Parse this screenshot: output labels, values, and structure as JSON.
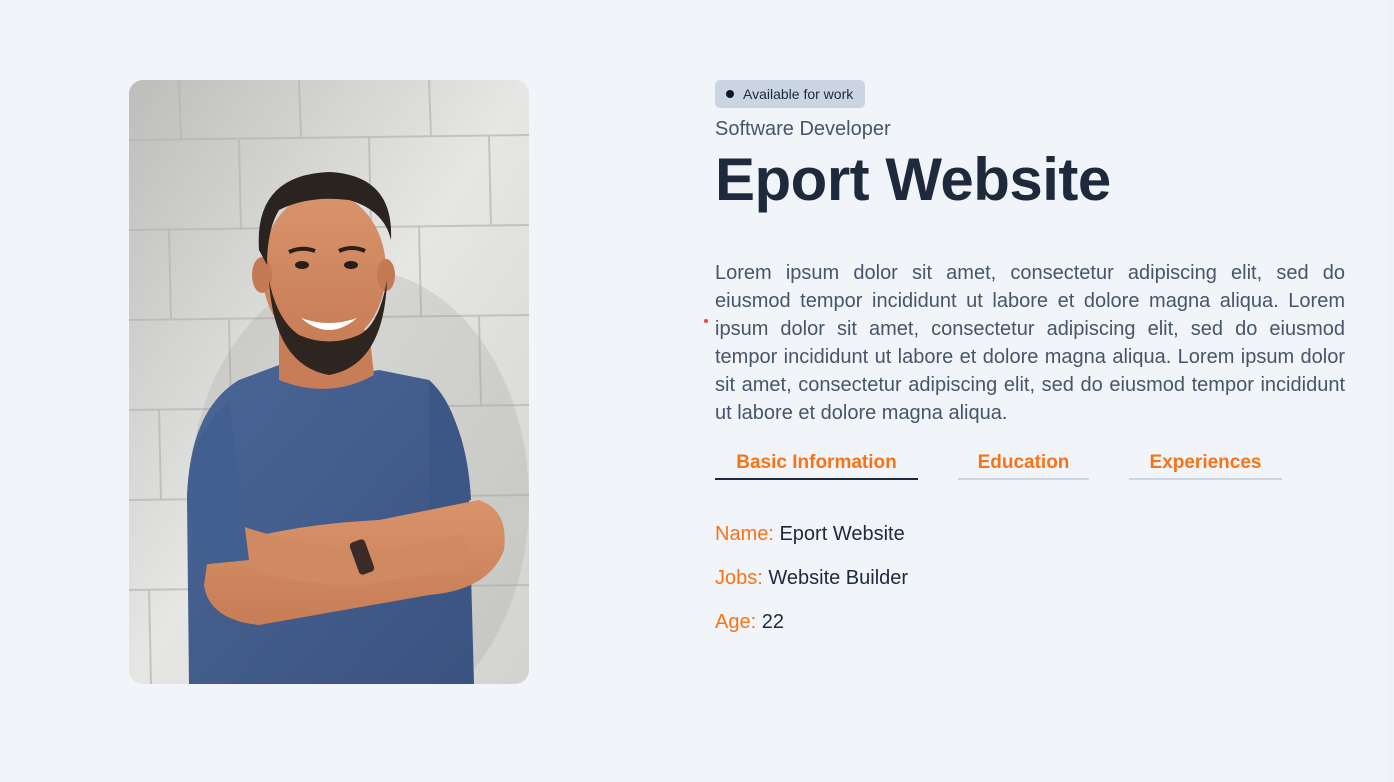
{
  "profile": {
    "photo_alt": "Smiling man with beard in blue t-shirt, arms crossed, against a white brick wall",
    "status_badge": "Available for work",
    "role": "Software Developer",
    "name": "Eport Website",
    "bio": "Lorem ipsum dolor sit amet, consectetur adipiscing elit, sed do eiusmod tempor incididunt ut labore et dolore magna aliqua. Lorem ipsum dolor sit amet, consectetur adipiscing elit, sed do eiusmod tempor incididunt ut labore et dolore magna aliqua. Lorem ipsum dolor sit amet, consectetur adipiscing elit, sed do eiusmod tempor incididunt ut labore et dolore magna aliqua."
  },
  "tabs": [
    {
      "label": "Basic Information",
      "active": true
    },
    {
      "label": "Education",
      "active": false
    },
    {
      "label": "Experiences",
      "active": false
    }
  ],
  "details": [
    {
      "label": "Name:",
      "value": "Eport Website"
    },
    {
      "label": "Jobs:",
      "value": "Website Builder"
    },
    {
      "label": "Age:",
      "value": "22"
    }
  ],
  "colors": {
    "background": "#f1f5f9",
    "accent": "#f97316",
    "heading": "#1e293b",
    "body_text": "#475569",
    "badge_bg": "#cbd5e1"
  }
}
